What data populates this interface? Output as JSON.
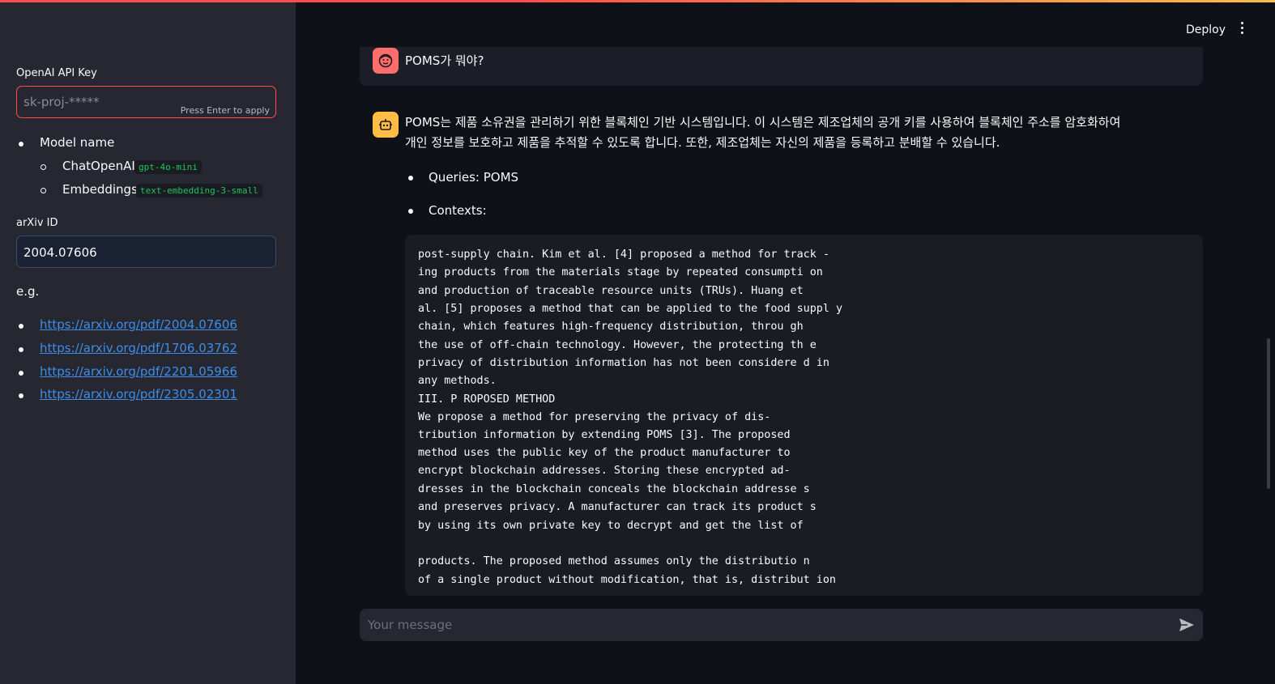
{
  "sidebar": {
    "api_key_label": "OpenAI API Key",
    "api_key_placeholder": "sk-proj-*****",
    "press_enter": "Press Enter to apply",
    "model_name_label": "Model name",
    "chat_model_label": "ChatOpenAI:",
    "chat_model_value": "gpt-4o-mini",
    "embeddings_label": "Embeddings:",
    "embeddings_value": "text-embedding-3-small",
    "arxiv_label": "arXiv ID",
    "arxiv_value": "2004.07606",
    "eg_label": "e.g.",
    "links": [
      "https://arxiv.org/pdf/2004.07606",
      "https://arxiv.org/pdf/1706.03762",
      "https://arxiv.org/pdf/2201.05966",
      "https://arxiv.org/pdf/2305.02301"
    ]
  },
  "header": {
    "deploy_label": "Deploy",
    "menu_icon": "more-vertical-icon"
  },
  "chat": {
    "user_message": "POMS가 뭐야?",
    "assistant_line1": "POMS는 제품 소유권을 관리하기 위한 블록체인 기반 시스템입니다. 이 시스템은 제조업체의 공개 키를 사용하여 블록체인 주소를 암호화하여",
    "assistant_line2": "개인 정보를 보호하고 제품을 추적할 수 있도록 합니다. 또한, 제조업체는 자신의 제품을 등록하고 분배할 수 있습니다.",
    "queries_text": "Queries: POMS",
    "contexts_label": "Contexts:",
    "context_lines": [
      "post-supply chain. Kim et al. [4] proposed a method for track -",
      "ing products from the materials stage by repeated consumpti on",
      "and production of traceable resource units (TRUs). Huang et",
      "al. [5] proposes a method that can be applied to the food suppl y",
      "chain, which features high-frequency distribution, throu gh",
      "the use of off-chain technology. However, the protecting th e",
      "privacy of distribution information has not been considere d in",
      "any methods.",
      "III. P ROPOSED METHOD",
      "We propose a method for preserving the privacy of dis-",
      "tribution information by extending POMS [3]. The proposed",
      "method uses the public key of the product manufacturer to",
      "encrypt blockchain addresses. Storing these encrypted ad-",
      "dresses in the blockchain conceals the blockchain addresse s",
      "and preserves privacy. A manufacturer can track its product s",
      "by using its own private key to decrypt and get the list of",
      "",
      "products. The proposed method assumes only the distributio n",
      "of a single product without modification, that is, distribut ion"
    ],
    "input_placeholder": "Your message"
  },
  "colors": {
    "accent": "#ff4b4b",
    "user_avatar": "#ff6c6c",
    "bot_avatar": "#ffbd45",
    "link": "#3d8ee8",
    "code_green": "#21c354"
  }
}
